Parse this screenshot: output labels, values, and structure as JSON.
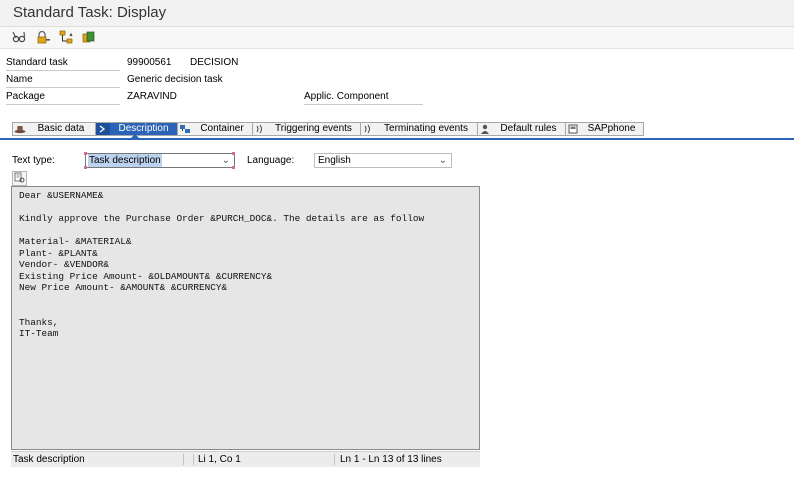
{
  "window": {
    "title": "Standard Task: Display"
  },
  "toolbar": {
    "buttons": [
      {
        "icon": "glasses-icon"
      },
      {
        "icon": "lock-key-icon"
      },
      {
        "icon": "hierarchy-icon"
      },
      {
        "icon": "transport-icon"
      }
    ]
  },
  "header": {
    "standard_task": {
      "label": "Standard task",
      "id": "99900561",
      "abbr": "DECISION"
    },
    "name": {
      "label": "Name",
      "value": "Generic decision task"
    },
    "package": {
      "label": "Package",
      "value": "ZARAVIND"
    },
    "applic_component": {
      "label": "Applic. Component",
      "value": ""
    }
  },
  "tabs": [
    {
      "label": "Basic data",
      "icon": "hat-icon",
      "active": false
    },
    {
      "label": "Description",
      "icon": "text-icon",
      "active": true
    },
    {
      "label": "Container",
      "icon": "container-icon",
      "active": false
    },
    {
      "label": "Triggering events",
      "icon": "event-waves-icon",
      "active": false
    },
    {
      "label": "Terminating events",
      "icon": "event-waves-icon",
      "active": false
    },
    {
      "label": "Default rules",
      "icon": "person-icon",
      "active": false
    },
    {
      "label": "SAPphone",
      "icon": "phone-icon",
      "active": false
    }
  ],
  "description": {
    "text_type_label": "Text type:",
    "text_type_value": "Task description",
    "language_label": "Language:",
    "language_value": "English",
    "editor_lines": [
      "Dear &USERNAME&",
      "",
      "Kindly approve the Purchase Order &PURCH_DOC&. The details are as follow",
      "",
      "Material- &MATERIAL&",
      "Plant- &PLANT&",
      "Vendor- &VENDOR&",
      "Existing Price Amount- &OLDAMOUNT& &CURRENCY&",
      "New Price Amount- &AMOUNT& &CURRENCY&",
      "",
      "",
      "Thanks,",
      "IT-Team"
    ],
    "status": {
      "context": "Task description",
      "position": "Li 1, Co 1",
      "range": "Ln 1 - Ln 13 of 13 lines"
    }
  },
  "colors": {
    "tab_active": "#2b63b6",
    "editor_bg": "#e6e6e6"
  }
}
